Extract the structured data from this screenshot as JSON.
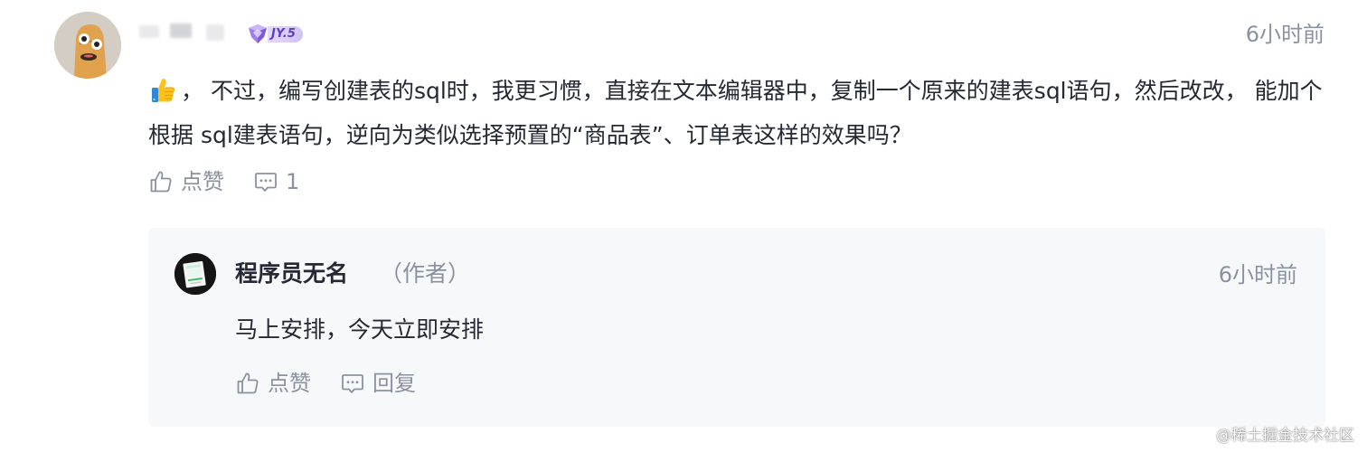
{
  "comment": {
    "level_badge": "JY.5",
    "time": "6小时前",
    "emoji": "thumbs-up-emoji",
    "text": "， 不过，编写创建表的sql时，我更习惯，直接在文本编辑器中，复制一个原来的建表sql语句，然后改改， 能加个根据 sql建表语句，逆向为类似选择预置的“商品表”、订单表这样的效果吗？",
    "like_label": "点赞",
    "reply_count": "1"
  },
  "reply": {
    "author_name": "程序员无名",
    "author_tag": "（作者）",
    "time": "6小时前",
    "text": "马上安排，今天立即安排",
    "like_label": "点赞",
    "reply_label": "回复"
  },
  "watermark": "@稀土掘金技术社区",
  "colors": {
    "text_primary": "#252933",
    "text_secondary": "#8a919f",
    "reply_background": "#f7f8fa",
    "badge_purple": "#5b3fc2"
  },
  "icons": {
    "like": "thumbs-up-icon",
    "comment": "comment-bubble-icon",
    "level": "level-gem-icon"
  }
}
